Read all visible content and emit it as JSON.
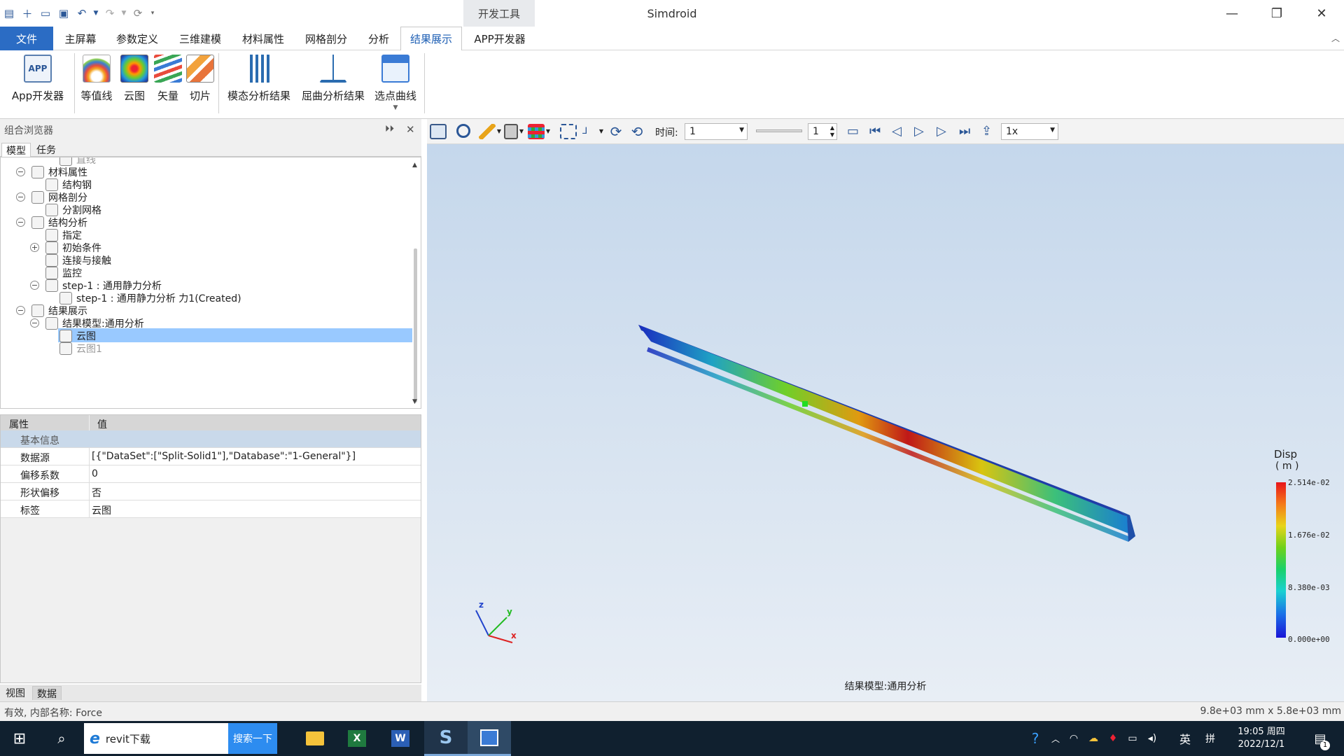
{
  "app": {
    "title": "Simdroid",
    "dev_tools_tab": "开发工具"
  },
  "menu": {
    "tabs": [
      "文件",
      "主屏幕",
      "参数定义",
      "三维建模",
      "材料属性",
      "网格剖分",
      "分析",
      "结果展示",
      "APP开发器"
    ],
    "active": "结果展示"
  },
  "ribbon": {
    "buttons": [
      {
        "label": "App开发器",
        "icon": "app-developer-icon"
      },
      {
        "label": "等值线",
        "icon": "contour-line-icon"
      },
      {
        "label": "云图",
        "icon": "cloud-map-icon"
      },
      {
        "label": "矢量",
        "icon": "vector-icon"
      },
      {
        "label": "切片",
        "icon": "slice-icon"
      },
      {
        "label": "模态分析结果",
        "icon": "modal-result-icon"
      },
      {
        "label": "屈曲分析结果",
        "icon": "buckling-result-icon"
      },
      {
        "label": "选点曲线",
        "icon": "point-curve-icon"
      }
    ]
  },
  "browser": {
    "title": "组合浏览器",
    "tabs": [
      "模型",
      "任务"
    ],
    "tree": [
      {
        "label": "直线",
        "level": 3,
        "grey": true
      },
      {
        "label": "材料属性",
        "level": 1,
        "expander": "−"
      },
      {
        "label": "结构钢",
        "level": 2
      },
      {
        "label": "网格剖分",
        "level": 1,
        "expander": "−"
      },
      {
        "label": "分割网格",
        "level": 2
      },
      {
        "label": "结构分析",
        "level": 1,
        "expander": "−"
      },
      {
        "label": "指定",
        "level": 2
      },
      {
        "label": "初始条件",
        "level": 2,
        "expander": "+"
      },
      {
        "label": "连接与接触",
        "level": 2
      },
      {
        "label": "监控",
        "level": 2
      },
      {
        "label": "step-1 : 通用静力分析",
        "level": 2,
        "expander": "−"
      },
      {
        "label": "step-1 : 通用静力分析 力1(Created)",
        "level": 3
      },
      {
        "label": "结果展示",
        "level": 1,
        "expander": "−"
      },
      {
        "label": "结果模型:通用分析",
        "level": 2,
        "expander": "−"
      },
      {
        "label": "云图",
        "level": 3,
        "selected": true
      },
      {
        "label": "云图1",
        "level": 3,
        "grey": true
      }
    ]
  },
  "properties": {
    "col_key": "属性",
    "col_value": "值",
    "group": "基本信息",
    "rows": [
      {
        "key": "数据源",
        "value": "[{\"DataSet\":[\"Split-Solid1\"],\"Database\":\"1-General\"}]"
      },
      {
        "key": "偏移系数",
        "value": "0"
      },
      {
        "key": "形状偏移",
        "value": "否"
      },
      {
        "key": "标签",
        "value": "云图"
      }
    ]
  },
  "bottom_tabs": [
    "视图",
    "数据"
  ],
  "viewer": {
    "time_label": "时间:",
    "time_value": "1",
    "frame_value": "1",
    "speed": "1x",
    "model_caption": "结果模型:通用分析",
    "axes": {
      "x": "x",
      "y": "y",
      "z": "z"
    },
    "legend": {
      "title": "Disp",
      "unit": "( m )",
      "ticks": [
        "2.514e-02",
        "1.676e-02",
        "8.380e-03",
        "0.000e+00"
      ]
    }
  },
  "status": {
    "left": "有效, 内部名称: Force",
    "right": "9.8e+03 mm x 5.8e+03 mm"
  },
  "taskbar": {
    "search_text": "revit下载",
    "search_button": "搜索一下",
    "ime_lang": "英",
    "ime_mode": "拼",
    "time": "19:05 周四",
    "date": "2022/12/1",
    "notification_count": "1"
  }
}
